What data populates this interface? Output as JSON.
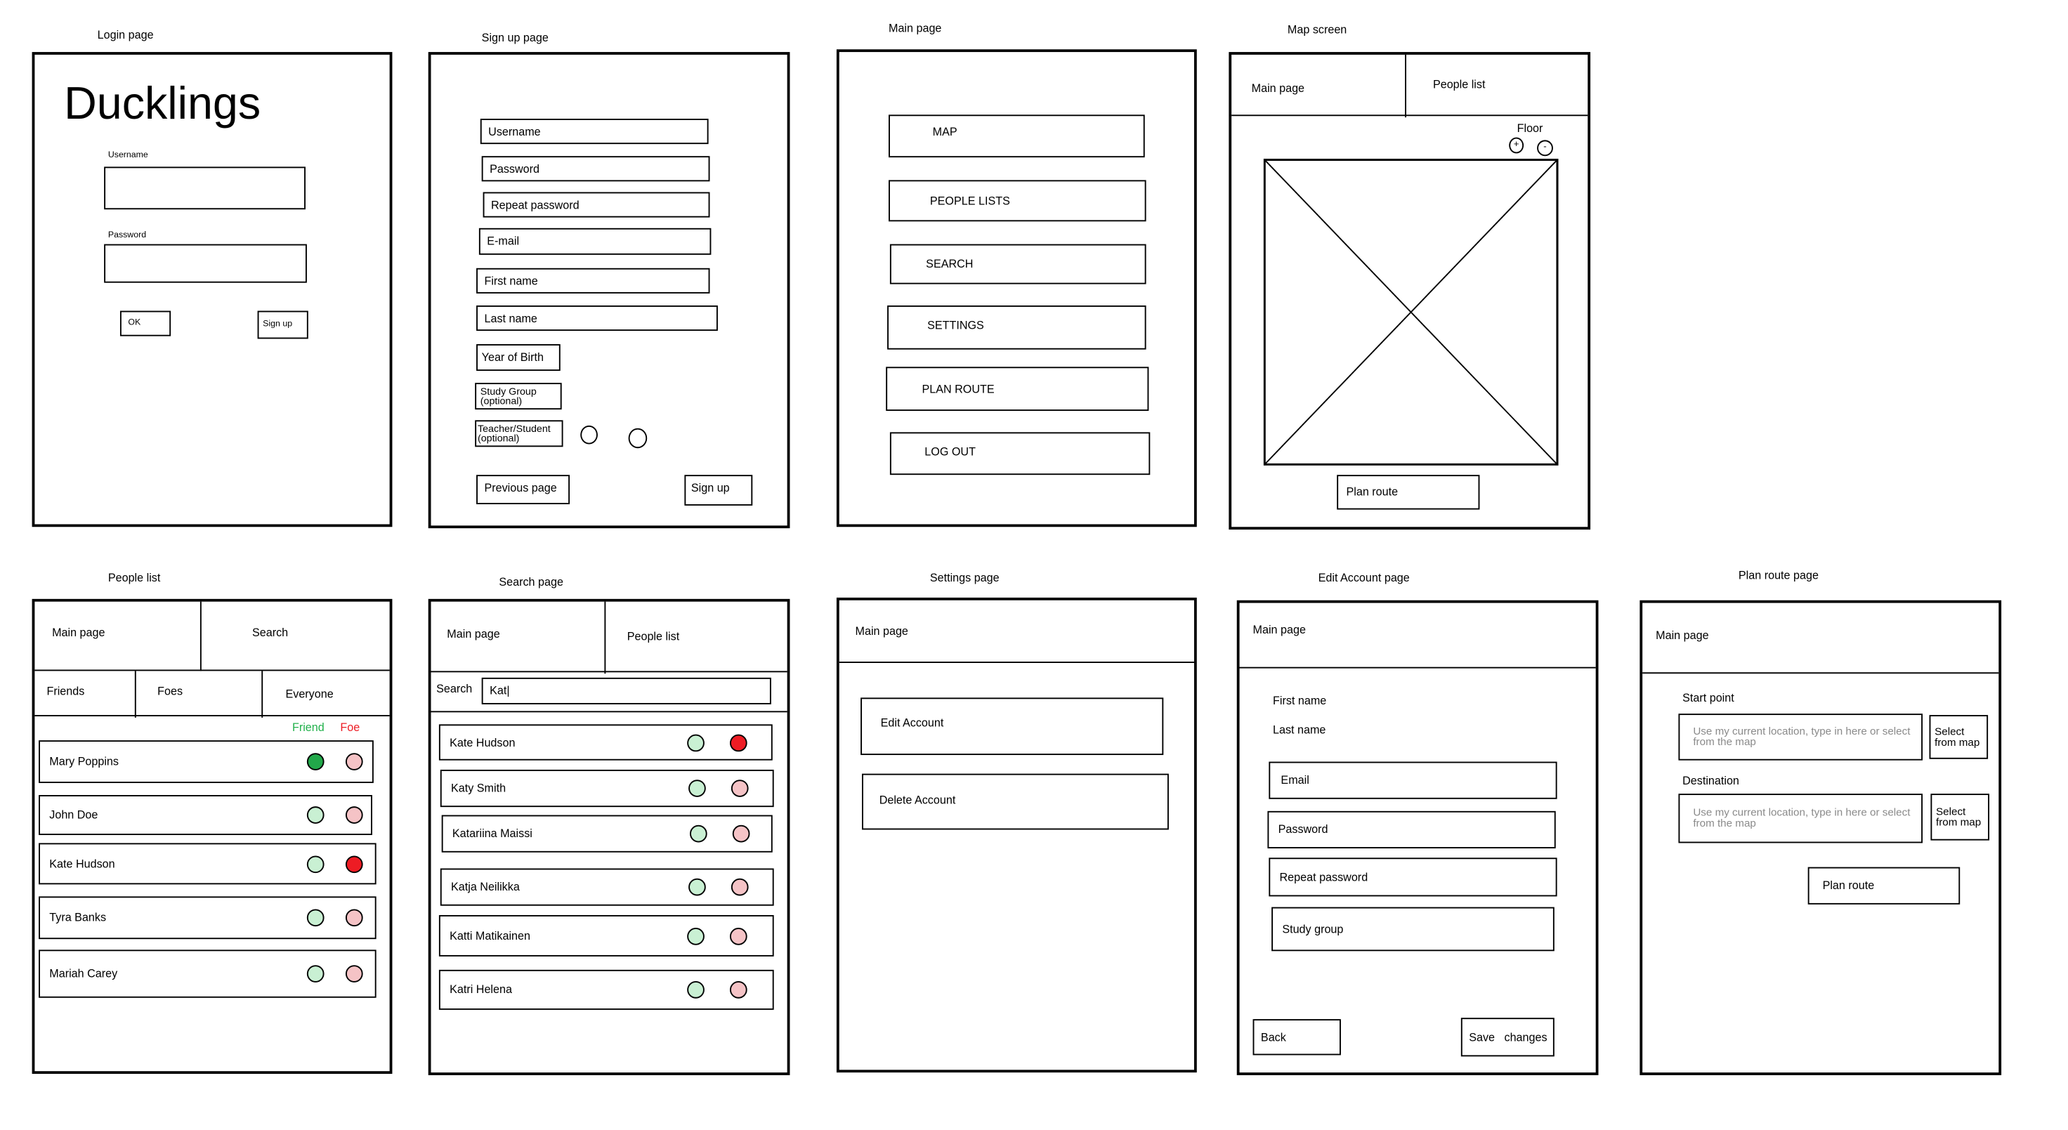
{
  "colors": {
    "friend_on": "#22a84a",
    "friend_off": "#c9f0d3",
    "foe_on": "#ed1c24",
    "foe_off": "#f5c3c6",
    "friend_label": "#22b14c",
    "foe_label": "#ed1c24"
  },
  "login": {
    "caption": "Login page",
    "app_title": "Ducklings",
    "username_label": "Username",
    "password_label": "Password",
    "ok": "OK",
    "signup": "Sign up"
  },
  "signup": {
    "caption": "Sign up page",
    "fields": [
      "Username",
      "Password",
      "Repeat password",
      "E-mail",
      "First name",
      "Last name",
      "Year of Birth",
      "Study Group (optional)",
      "Teacher/Student (optional)"
    ],
    "previous": "Previous page",
    "signup": "Sign up"
  },
  "main": {
    "caption": "Main page",
    "buttons": [
      "MAP",
      "PEOPLE LISTS",
      "SEARCH",
      "SETTINGS",
      "PLAN ROUTE",
      "LOG OUT"
    ]
  },
  "map": {
    "caption": "Map screen",
    "tab_main": "Main page",
    "tab_people": "People list",
    "floor_label": "Floor",
    "floor_up": "+",
    "floor_down": "-",
    "plan_route": "Plan route"
  },
  "people": {
    "caption": "People list",
    "tab_main": "Main page",
    "tab_search": "Search",
    "filters": [
      "Friends",
      "Foes",
      "Everyone"
    ],
    "friend_label": "Friend",
    "foe_label": "Foe",
    "rows": [
      {
        "name": "Mary Poppins",
        "friend": true,
        "foe": false
      },
      {
        "name": "John Doe",
        "friend": false,
        "foe": false
      },
      {
        "name": "Kate Hudson",
        "friend": false,
        "foe": true
      },
      {
        "name": "Tyra Banks",
        "friend": false,
        "foe": false
      },
      {
        "name": "Mariah Carey",
        "friend": false,
        "foe": false
      }
    ]
  },
  "search": {
    "caption": "Search page",
    "tab_main": "Main page",
    "tab_people": "People list",
    "search_label": "Search",
    "query": "Kat|",
    "rows": [
      {
        "name": "Kate Hudson",
        "friend": false,
        "foe": true
      },
      {
        "name": "Katy Smith",
        "friend": false,
        "foe": false
      },
      {
        "name": "Katariina Maissi",
        "friend": false,
        "foe": false
      },
      {
        "name": "Katja Neilikka",
        "friend": false,
        "foe": false
      },
      {
        "name": "Katti Matikainen",
        "friend": false,
        "foe": false
      },
      {
        "name": "Katri Helena",
        "friend": false,
        "foe": false
      }
    ]
  },
  "settings": {
    "caption": "Settings page",
    "tab_main": "Main page",
    "edit": "Edit Account",
    "delete": "Delete Account"
  },
  "edit": {
    "caption": "Edit Account page",
    "tab_main": "Main page",
    "first_name": "First name",
    "last_name": "Last name",
    "fields": [
      "Email",
      "Password",
      "Repeat password",
      "Study group"
    ],
    "back": "Back",
    "save": "Save   changes"
  },
  "route": {
    "caption": "Plan route page",
    "tab_main": "Main page",
    "start_label": "Start point",
    "dest_label": "Destination",
    "placeholder": "Use my current location, type in here or select from the map",
    "select_map": "Select from map",
    "plan_route": "Plan route"
  }
}
